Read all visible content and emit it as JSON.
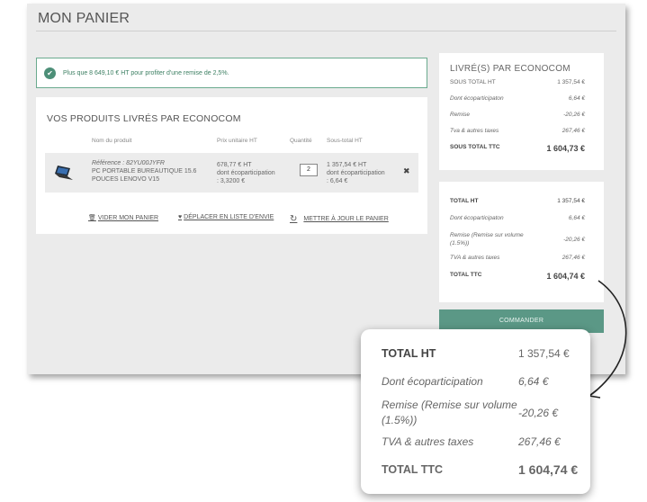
{
  "page_title": "MON PANIER",
  "alert": {
    "text": "Plus que 8 649,10 € HT pour profiter d'une remise de 2,5%."
  },
  "products": {
    "title": "VOS PRODUITS LIVRÉS PAR ECONOCOM",
    "headers": [
      "Nom du produit",
      "Prix unitaire HT",
      "Quantité",
      "Sous-total HT"
    ],
    "item": {
      "reference": "Référence : 82YU00JYFR",
      "name_line1": "PC PORTABLE BUREAUTIQUE 15.6",
      "name_line2": "POUCES LENOVO V15",
      "price_line1": "678,77 € HT",
      "price_line2": "dont écoparticipation",
      "price_line3": ": 3,3200 €",
      "quantity": "2",
      "subtotal_line1": "1 357,54 € HT",
      "subtotal_line2": "dont écoparticipation",
      "subtotal_line3": ": 6,64 €",
      "remove_glyph": "✖"
    },
    "actions": {
      "empty": "VIDER MON PANIER",
      "wishlist": "DÉPLACER EN LISTE D'ENVIE",
      "update": "METTRE À JOUR LE PANIER"
    }
  },
  "summary1": {
    "title": "LIVRÉ(S) PAR ECONOCOM",
    "rows": [
      {
        "label": "SOUS TOTAL HT",
        "value": "1 357,54 €"
      },
      {
        "label": "Dont écoparticipaton",
        "value": "6,64 €"
      },
      {
        "label": "Remise",
        "value": "-20,26 €"
      },
      {
        "label": "Tva & autres taxes",
        "value": "267,46 €"
      },
      {
        "label": "SOUS TOTAL TTC",
        "value": "1 604,73 €"
      }
    ]
  },
  "summary2": {
    "rows": [
      {
        "label": "TOTAL HT",
        "value": "1 357,54 €"
      },
      {
        "label": "Dont écoparticipaton",
        "value": "6,64 €"
      },
      {
        "label": "Remise (Remise sur volume (1.5%))",
        "value": "-20,26 €"
      },
      {
        "label": "TVA & autres taxes",
        "value": "267,46 €"
      },
      {
        "label": "TOTAL TTC",
        "value": "1 604,74 €"
      }
    ]
  },
  "checkout_button": "COMMANDER",
  "callout": {
    "rows": [
      {
        "label": "TOTAL HT",
        "value": "1 357,54 €"
      },
      {
        "label": "Dont écoparticipation",
        "value": "6,64 €"
      },
      {
        "label": "Remise (Remise sur volume (1.5%))",
        "value": "-20,26 €"
      },
      {
        "label": "TVA & autres taxes",
        "value": "267,46 €"
      },
      {
        "label": "TOTAL TTC",
        "value": "1 604,74 €"
      }
    ]
  },
  "colors": {
    "accent": "#5b9886",
    "alert_border": "#6aaa8e",
    "background": "#ebebeb"
  }
}
